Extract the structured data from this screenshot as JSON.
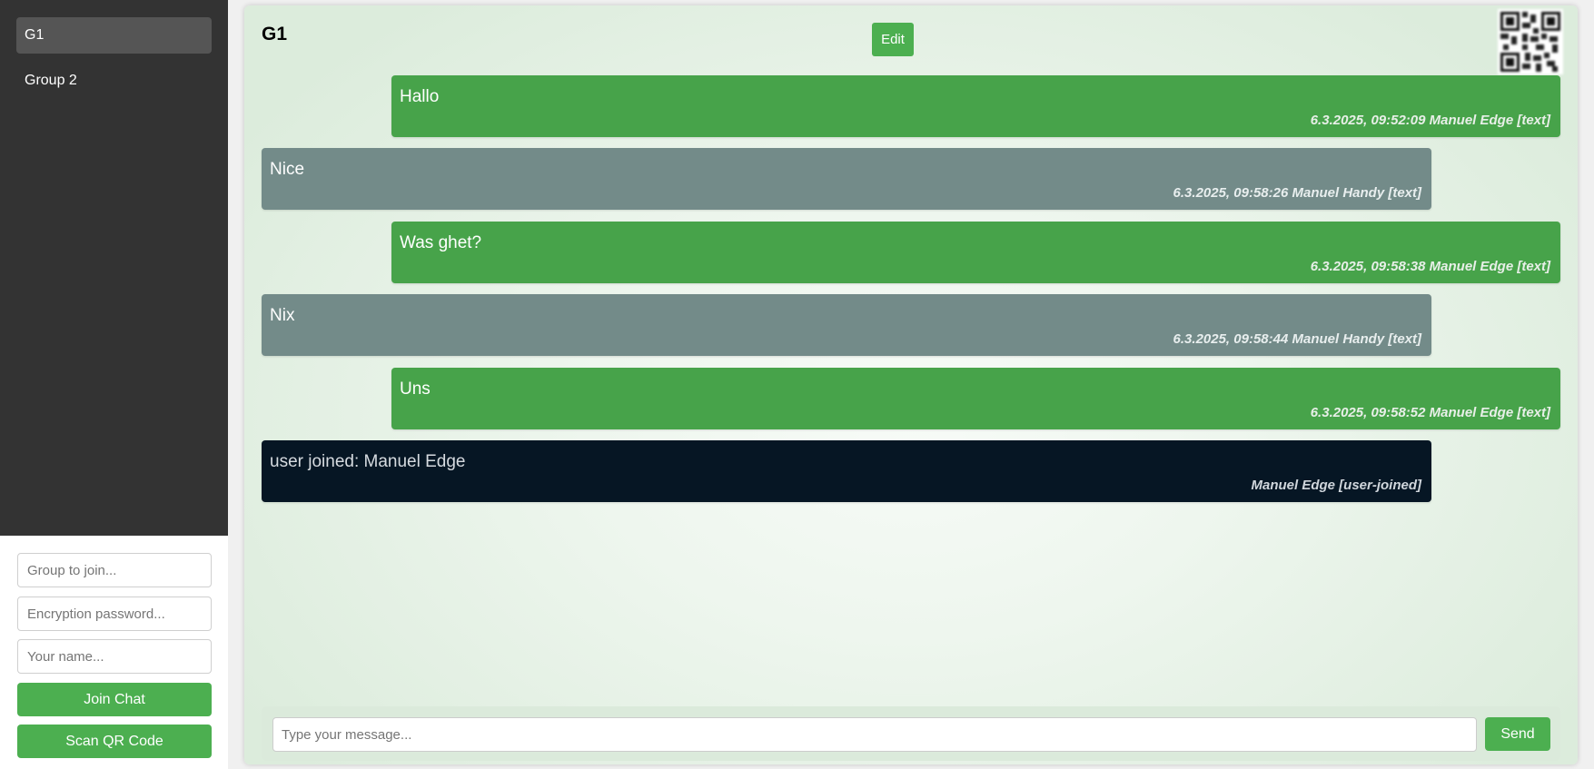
{
  "sidebar": {
    "groups": [
      {
        "label": "G1",
        "active": true
      },
      {
        "label": "Group 2",
        "active": false
      }
    ]
  },
  "join": {
    "group_placeholder": "Group to join...",
    "password_placeholder": "Encryption password...",
    "name_placeholder": "Your name...",
    "join_label": "Join Chat",
    "scan_label": "Scan QR Code"
  },
  "chat": {
    "title": "G1",
    "edit_label": "Edit",
    "messages": [
      {
        "text": "Hallo",
        "meta": "6.3.2025, 09:52:09 Manuel Edge [text]",
        "kind": "own"
      },
      {
        "text": "Nice",
        "meta": "6.3.2025, 09:58:26 Manuel Handy [text]",
        "kind": "other"
      },
      {
        "text": "Was ghet?",
        "meta": "6.3.2025, 09:58:38 Manuel Edge [text]",
        "kind": "own"
      },
      {
        "text": "Nix",
        "meta": "6.3.2025, 09:58:44 Manuel Handy [text]",
        "kind": "other"
      },
      {
        "text": "Uns",
        "meta": "6.3.2025, 09:58:52 Manuel Edge [text]",
        "kind": "own"
      },
      {
        "text": "user joined: Manuel Edge",
        "meta": "Manuel Edge [user-joined]",
        "kind": "system"
      }
    ],
    "composer": {
      "placeholder": "Type your message...",
      "send_label": "Send"
    }
  },
  "colors": {
    "accent": "#4caf50",
    "own_bubble": "#47a34a",
    "other_bubble": "#738b89",
    "system_bubble": "#061624",
    "sidebar_bg": "#333333"
  },
  "icons": {
    "qr": "qr-code-icon"
  }
}
